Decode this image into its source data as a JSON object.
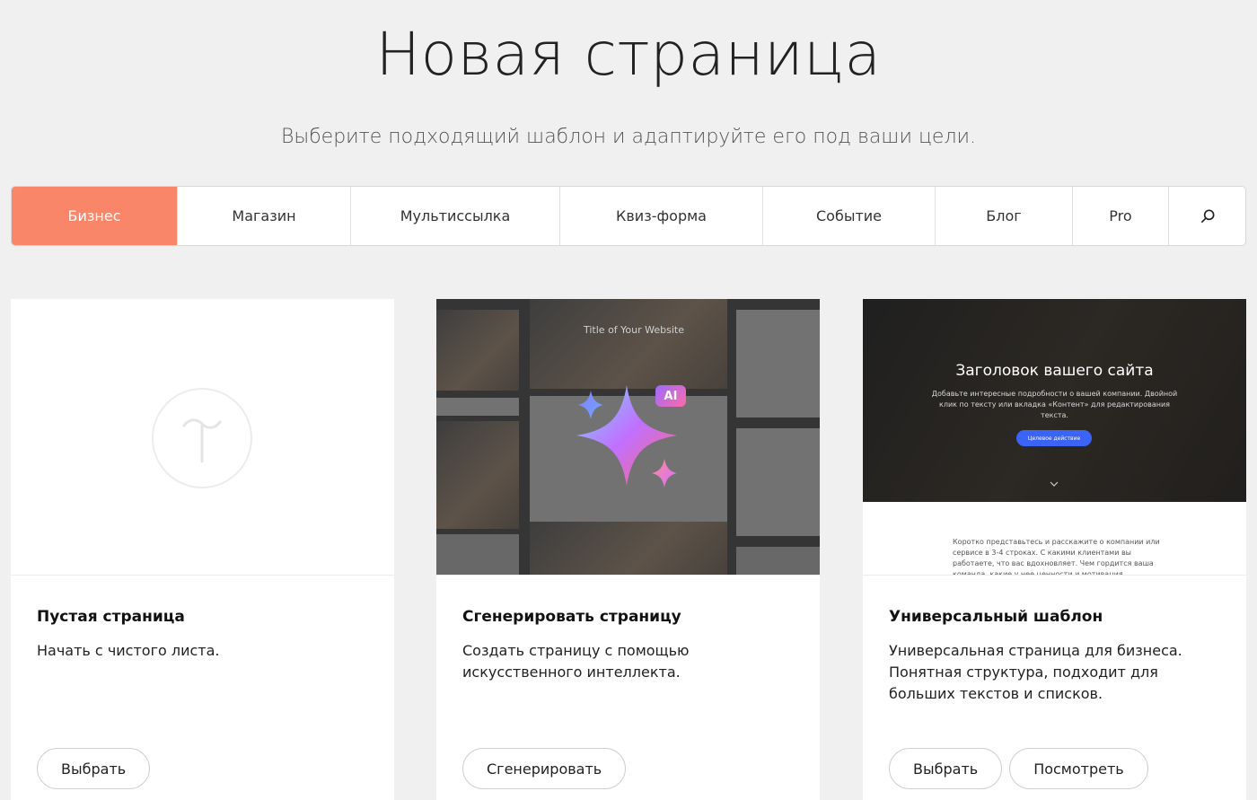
{
  "header": {
    "title": "Новая страница",
    "subtitle": "Выберите подходящий шаблон и адаптируйте его под ваши цели."
  },
  "tabs": [
    {
      "label": "Бизнес",
      "active": true
    },
    {
      "label": "Магазин",
      "active": false
    },
    {
      "label": "Мультиссылка",
      "active": false
    },
    {
      "label": "Квиз-форма",
      "active": false
    },
    {
      "label": "Событие",
      "active": false
    },
    {
      "label": "Блог",
      "active": false
    },
    {
      "label": "Pro",
      "active": false
    }
  ],
  "search_icon": "search-icon",
  "colors": {
    "accent": "#fa8669",
    "background": "#f0f0f0",
    "ai_button": "#3b63f5"
  },
  "cards": [
    {
      "title": "Пустая страница",
      "description": "Начать с чистого листа.",
      "buttons": [
        "Выбрать"
      ]
    },
    {
      "title": "Сгенерировать страницу",
      "description": "Создать страницу с помощью искусственного интеллекта.",
      "buttons": [
        "Сгенерировать"
      ],
      "preview": {
        "title": "Title of Your Website",
        "badge": "AI"
      }
    },
    {
      "title": "Универсальный шаблон",
      "description": "Универсальная страница для бизнеса. Понятная структура, подходит для больших текстов и списков.",
      "buttons": [
        "Выбрать",
        "Посмотреть"
      ],
      "preview": {
        "hero_title": "Заголовок вашего сайта",
        "hero_subtitle": "Добавьте интересные подробности о вашей компании. Двойной клик по тексту или вкладка «Контент» для редактирования текста.",
        "hero_button": "Целевое действие",
        "body_text": "Коротко представьтесь и расскажите о компании или сервисе в 3-4 строках. С какими клиентами вы работаете, что вас вдохновляет. Чем гордится ваша команда, какие у нее ценности и мотивация."
      }
    }
  ]
}
